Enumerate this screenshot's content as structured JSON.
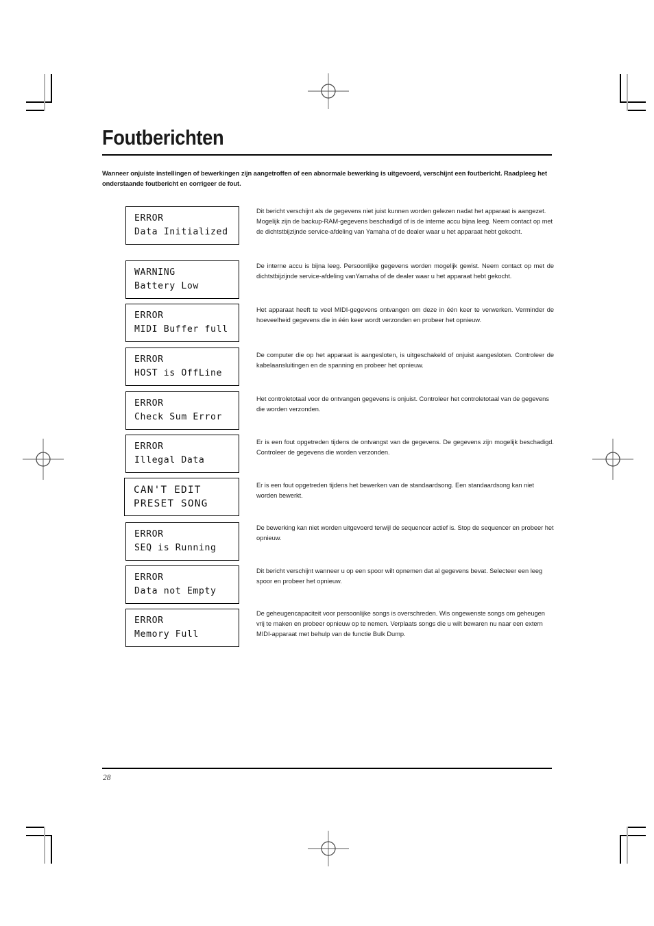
{
  "page": {
    "title": "Foutberichten",
    "intro": "Wanneer onjuiste instellingen of bewerkingen zijn aangetroffen of een abnormale bewerking is uitgevoerd, verschijnt een foutbericht. Raadpleeg het onderstaande foutbericht en corrigeer de fout.",
    "number": "28"
  },
  "messages": [
    {
      "lcd_line1": "ERROR",
      "lcd_line2": "Data Initialized",
      "description": "Dit bericht verschijnt als de gegevens niet juist kunnen worden gelezen nadat het apparaat is aangezet. Mogelijk zijn de backup-RAM-gegevens beschadigd of is de interne accu bijna leeg. Neem contact op met de dichtstbijzijnde service-afdeling van Yamaha of de dealer waar u het apparaat hebt gekocht."
    },
    {
      "lcd_line1": "WARNING",
      "lcd_line2": "Battery Low",
      "description": "De interne accu is bijna leeg. Persoonlijke gegevens worden mogelijk gewist. Neem contact op met de dichtstbijzijnde service-afdeling vanYamaha of de dealer waar u het apparaat hebt gekocht."
    },
    {
      "lcd_line1": "ERROR",
      "lcd_line2": "MIDI Buffer full",
      "description": "Het apparaat heeft te veel MIDI-gegevens ontvangen om deze in één keer te verwerken. Verminder de hoeveelheid gegevens die in één keer wordt verzonden en probeer het opnieuw."
    },
    {
      "lcd_line1": "ERROR",
      "lcd_line2": "HOST is OffLine",
      "description": "De computer die op het apparaat is aangesloten, is uitgeschakeld of onjuist aangesloten. Controleer de kabelaansluitingen en de spanning en probeer het opnieuw."
    },
    {
      "lcd_line1": "ERROR",
      "lcd_line2": "Check Sum Error",
      "description": "Het controletotaal voor de ontvangen gegevens is onjuist. Controleer het controletotaal van de gegevens die worden verzonden."
    },
    {
      "lcd_line1": "ERROR",
      "lcd_line2": "Illegal Data",
      "description": "Er is een fout opgetreden tijdens de ontvangst van de gegevens. De gegevens zijn mogelijk beschadigd. Controleer de gegevens die worden verzonden."
    },
    {
      "lcd_line1": "CAN'T EDIT",
      "lcd_line2": "PRESET SONG",
      "description": "Er is een fout opgetreden tijdens het bewerken van de standaardsong. Een standaardsong kan niet worden bewerkt."
    },
    {
      "lcd_line1": "ERROR",
      "lcd_line2": "SEQ is Running",
      "description": "De bewerking kan niet worden uitgevoerd terwijl de sequencer actief is. Stop de sequencer en probeer het opnieuw."
    },
    {
      "lcd_line1": "ERROR",
      "lcd_line2": "Data not Empty",
      "description": "Dit bericht verschijnt wanneer u op een spoor wilt opnemen dat al gegevens bevat. Selecteer een leeg spoor en probeer het opnieuw."
    },
    {
      "lcd_line1": "ERROR",
      "lcd_line2": "Memory Full",
      "description": "De geheugencapaciteit voor persoonlijke songs is overschreden. Wis ongewenste songs om geheugen vrij te maken en probeer opnieuw op te nemen. Verplaats songs die u wilt bewaren nu naar een extern MIDI-apparaat met behulp van de functie Bulk Dump."
    }
  ]
}
